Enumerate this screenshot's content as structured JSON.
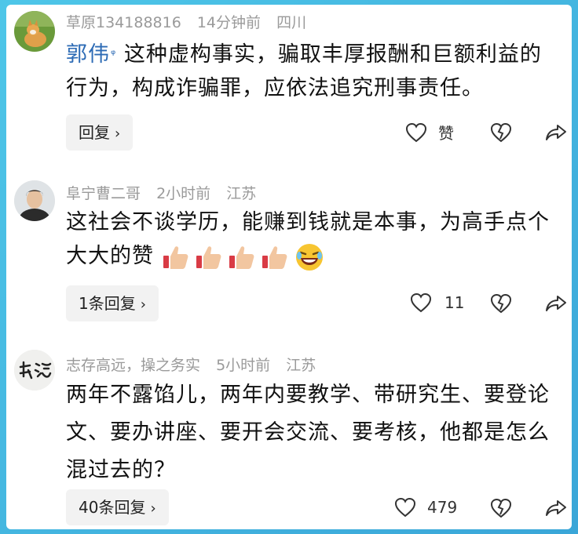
{
  "comments": [
    {
      "user": "草原134188816",
      "time": "14分钟前",
      "location": "四川",
      "mention": "郭伟",
      "text": "这种虚构事实，骗取丰厚报酬和巨额利益的行为，构成诈骗罪，应依法追究刑事责任。",
      "reply_label": "回复",
      "like_label": "赞",
      "avatar_icon": "dog-avatar-icon"
    },
    {
      "user": "阜宁曹二哥",
      "time": "2小时前",
      "location": "江苏",
      "text": "这社会不谈学历，能赚到钱就是本事，为高手点个大大的赞",
      "reply_label": "1条回复",
      "like_count": "11",
      "avatar_icon": "person-avatar-icon"
    },
    {
      "user": "志存高远，操之务实",
      "time": "5小时前",
      "location": "江苏",
      "text": "两年不露馅儿，两年内要教学、带研究生、要登论文、要办讲座、要开会交流、要考核，他都是怎么混过去的？",
      "reply_label": "40条回复",
      "like_count": "479",
      "avatar_icon": "calligraphy-avatar-icon"
    }
  ],
  "colors": {
    "mention": "#2d6bb5",
    "meta": "#9a9a9a",
    "background": "#3aa6d8"
  }
}
